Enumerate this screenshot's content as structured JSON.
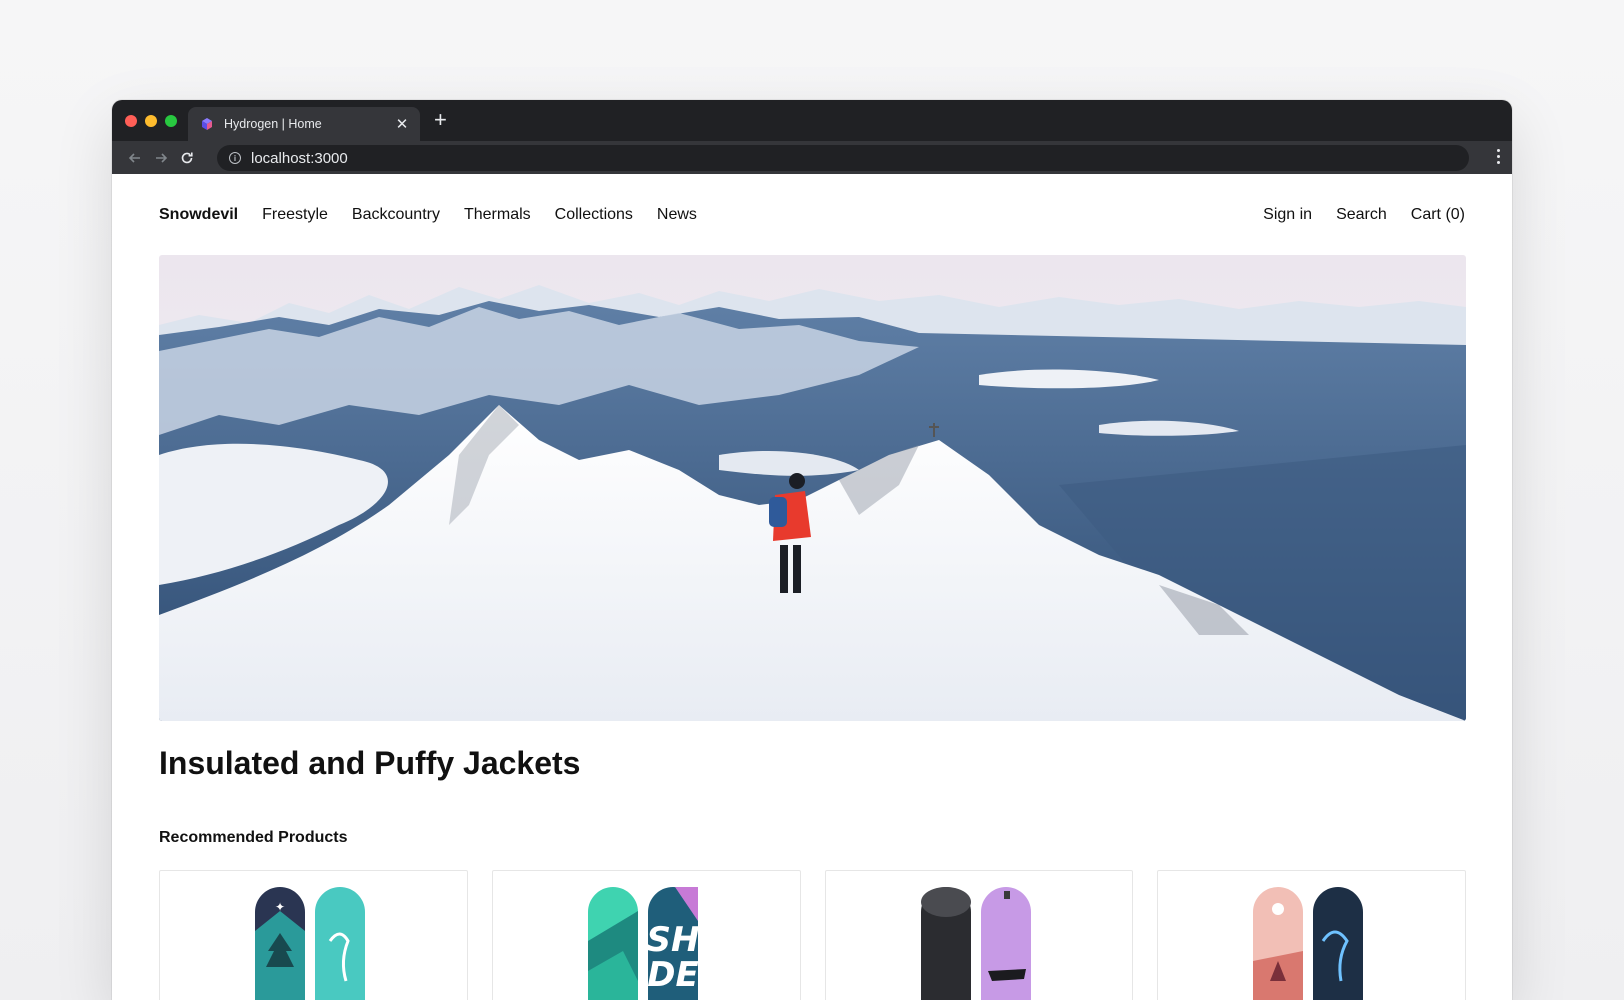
{
  "browser": {
    "tab_title": "Hydrogen | Home",
    "url": "localhost:3000",
    "traffic_lights": [
      "#ff5f57",
      "#febc2e",
      "#28c840"
    ]
  },
  "nav": {
    "brand": "Snowdevil",
    "links": [
      "Freestyle",
      "Backcountry",
      "Thermals",
      "Collections",
      "News"
    ],
    "sign_in": "Sign in",
    "search": "Search",
    "cart": "Cart (0)"
  },
  "hero": {
    "image": "mountain-hiker-snow-scene"
  },
  "headline": "Insulated and Puffy Jackets",
  "recommended": {
    "title": "Recommended Products",
    "products": [
      {
        "image": "snowboard-pair-teal-forest"
      },
      {
        "image": "snowboard-pair-mint-graphic"
      },
      {
        "image": "snowboard-pair-black-lavender"
      },
      {
        "image": "snowboard-pair-pink-navy"
      }
    ]
  }
}
